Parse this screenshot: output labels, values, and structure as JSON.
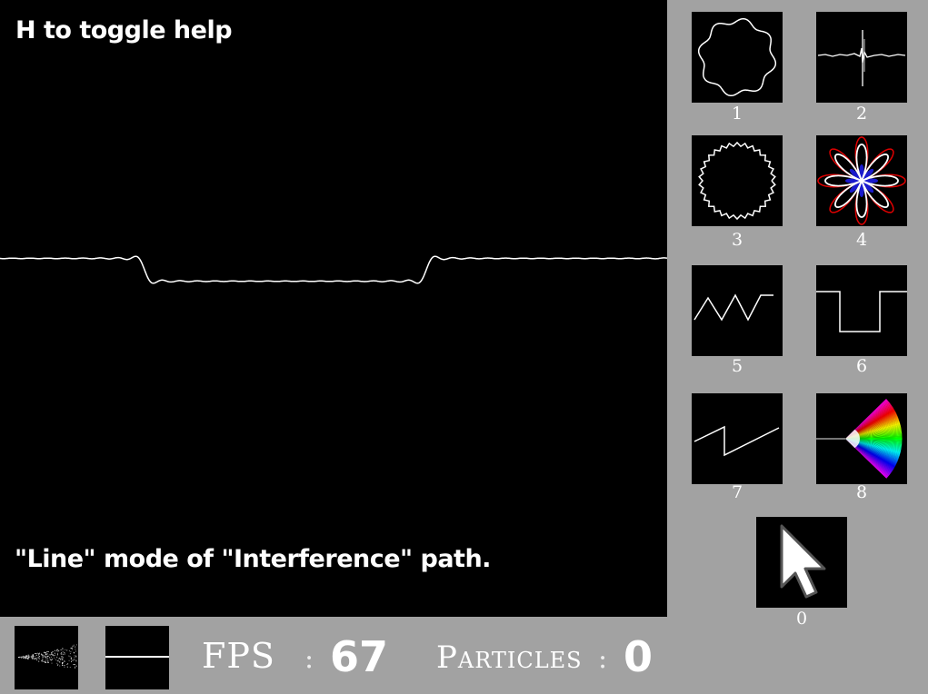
{
  "canvas": {
    "help_text": "H to toggle help",
    "mode_text": "\"Line\" mode of \"Interference\" path."
  },
  "paths": [
    {
      "number": "1",
      "icon": "wavy-circle-icon"
    },
    {
      "number": "2",
      "icon": "noise-cross-icon"
    },
    {
      "number": "3",
      "icon": "jagged-circle-icon"
    },
    {
      "number": "4",
      "icon": "flower-icon"
    },
    {
      "number": "5",
      "icon": "zigzag-icon"
    },
    {
      "number": "6",
      "icon": "square-wave-icon"
    },
    {
      "number": "7",
      "icon": "sawtooth-icon"
    },
    {
      "number": "8",
      "icon": "rainbow-fan-icon"
    },
    {
      "number": "0",
      "icon": "mouse-cursor-icon"
    }
  ],
  "stats": {
    "fps_label": "FPS",
    "fps_value": "67",
    "particles_label": "Particles",
    "particles_value": "0",
    "separator": ":"
  },
  "buttons": [
    {
      "icon": "spray-icon"
    },
    {
      "icon": "line-icon"
    }
  ]
}
